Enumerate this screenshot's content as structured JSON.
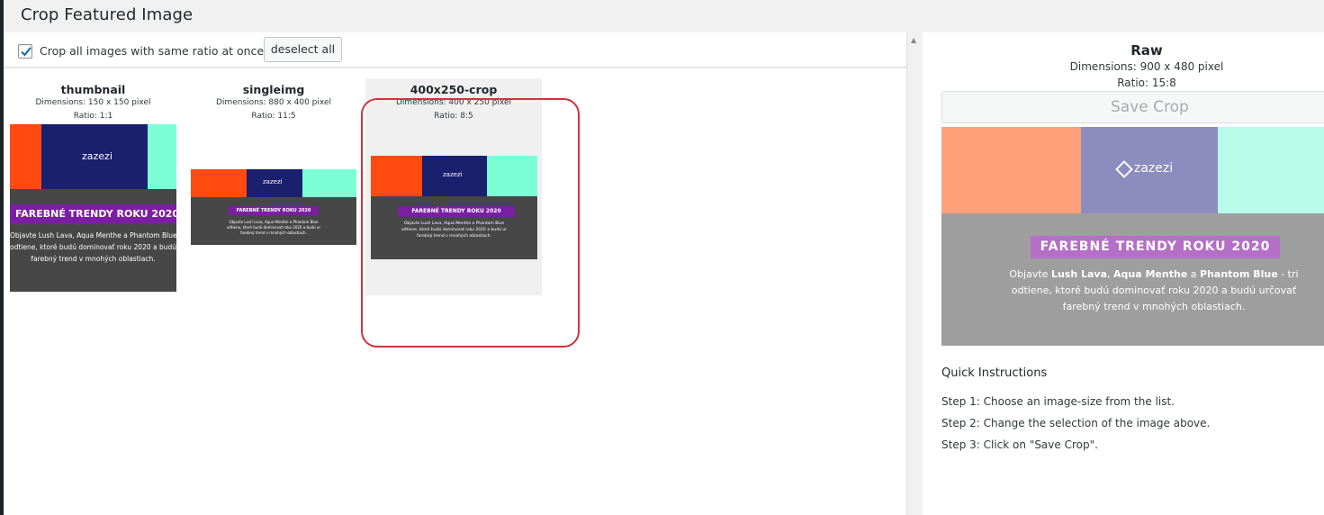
{
  "header": {
    "title": "Crop Featured Image"
  },
  "toolbar": {
    "crop_all_label": "Crop all images with same ratio at once",
    "crop_all_checked": true,
    "deselect_label": "deselect all"
  },
  "image_sizes": [
    {
      "name": "thumbnail",
      "dimensions": "Dimensions: 150 x 150 pixel",
      "ratio": "Ratio: 1:1"
    },
    {
      "name": "singleimg",
      "dimensions": "Dimensions: 880 x 400 pixel",
      "ratio": "Ratio: 11:5"
    },
    {
      "name": "400x250-crop",
      "dimensions": "Dimensions: 400 x 250 pixel",
      "ratio": "Ratio: 8:5"
    }
  ],
  "raw": {
    "title": "Raw",
    "dimensions": "Dimensions: 900 x 480 pixel",
    "ratio": "Ratio: 15:8",
    "save_label": "Save Crop"
  },
  "image_content": {
    "logo": "zazezi",
    "banner": "FAREBNÉ TRENDY ROKU 2020",
    "desc_prefix": "Objavte ",
    "desc_lava": "Lush Lava",
    "desc_sep1": ", ",
    "desc_menthe": "Aqua Menthe",
    "desc_sep2": " a ",
    "desc_blue": "Phantom Blue",
    "desc_rest1": " - tri",
    "desc_rest2": "odtiene, ktoré budú dominovať roku 2020 a budú určovať",
    "desc_rest3": "farebný trend v mnohých oblastiach.",
    "thumb_line1": "Objavte Lush Lava, Aqua Menthe a Phantom Blue",
    "thumb_line2": "odtiene, ktoré budú dominovať roku 2020 a budú ur",
    "thumb_line3": "farebný trend v mnohých oblastiach."
  },
  "instructions": {
    "title": "Quick Instructions",
    "step1": "Step 1: Choose an image-size from the list.",
    "step2": "Step 2: Change the selection of the image above.",
    "step3": "Step 3: Click on \"Save Crop\"."
  },
  "colors": {
    "lava": "#ff4a10",
    "navy": "#1a1f6e",
    "menthe": "#7dffd6",
    "dark": "#474747",
    "purple": "#7b1fa2",
    "highlight": "#d0343a"
  }
}
